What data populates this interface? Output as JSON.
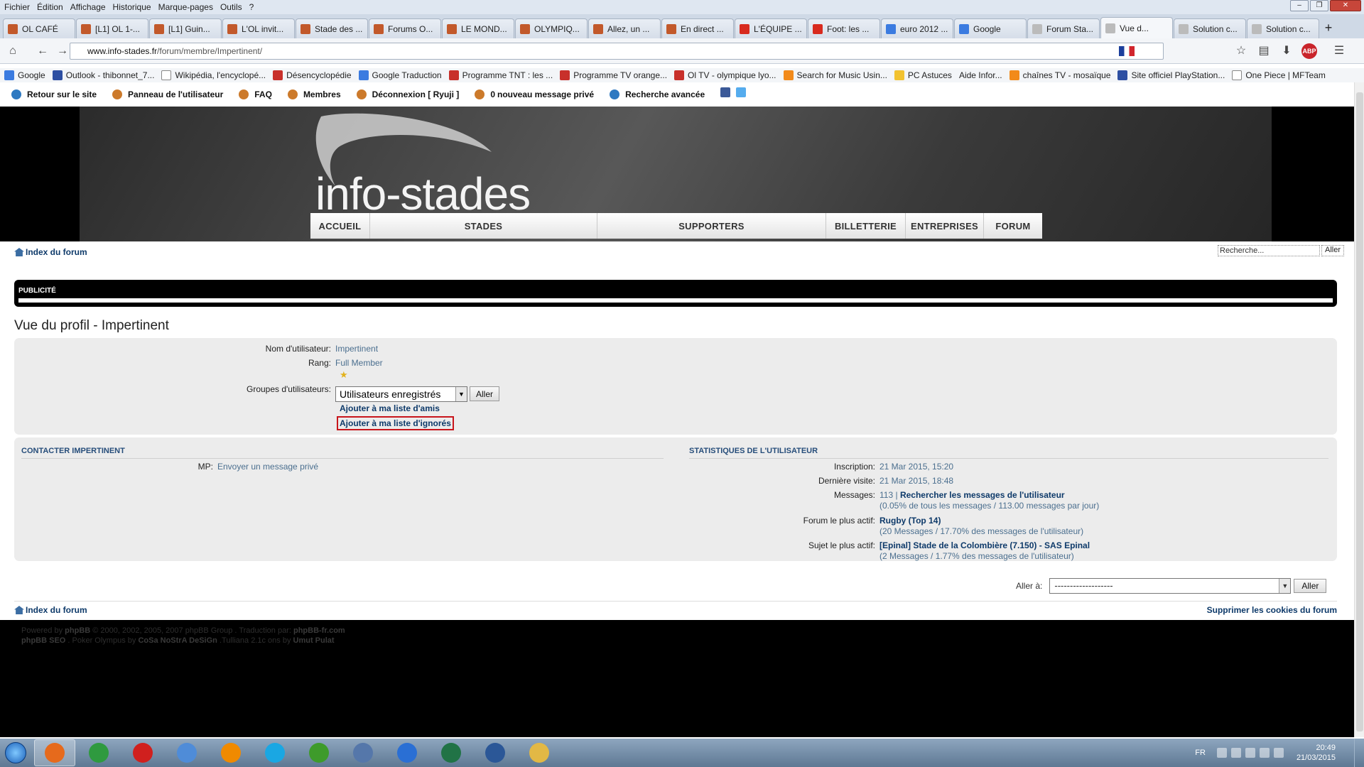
{
  "browser": {
    "menu": [
      "Fichier",
      "Édition",
      "Affichage",
      "Historique",
      "Marque-pages",
      "Outils",
      "?"
    ],
    "tabs": [
      {
        "label": "OL CAFÉ",
        "icon": "ol-favicon"
      },
      {
        "label": "[L1] OL 1-...",
        "icon": "ol-favicon"
      },
      {
        "label": "[L1] Guin...",
        "icon": "ol-favicon"
      },
      {
        "label": "L'OL invit...",
        "icon": "ol-favicon"
      },
      {
        "label": "Stade des ...",
        "icon": "ol-favicon"
      },
      {
        "label": "Forums O...",
        "icon": "ol-favicon"
      },
      {
        "label": "LE MOND...",
        "icon": "ol-favicon"
      },
      {
        "label": "OLYMPIQ...",
        "icon": "ol-favicon"
      },
      {
        "label": "Allez, un ...",
        "icon": "ol-favicon"
      },
      {
        "label": "En direct ...",
        "icon": "ol-favicon"
      },
      {
        "label": "L'ÉQUIPE ...",
        "icon": "lequipe-favicon"
      },
      {
        "label": "Foot: les ...",
        "icon": "lequipe-favicon"
      },
      {
        "label": "euro 2012 ...",
        "icon": "google-favicon"
      },
      {
        "label": "Google",
        "icon": "google-favicon"
      },
      {
        "label": "Forum Sta...",
        "icon": "page-favicon"
      },
      {
        "label": "Vue d...",
        "icon": "page-favicon",
        "active": true
      },
      {
        "label": "Solution c...",
        "icon": "page-favicon"
      },
      {
        "label": "Solution c...",
        "icon": "page-favicon"
      }
    ],
    "url_domain": "www.info-stades.fr",
    "url_path": "/forum/membre/Impertinent/",
    "bookmarks": [
      {
        "label": "Google",
        "icon": "google-icon",
        "c": ""
      },
      {
        "label": "Outlook - thibonnet_7...",
        "icon": "outlook-icon",
        "c": "b"
      },
      {
        "label": "Wikipédia, l'encyclopé...",
        "icon": "wikipedia-icon",
        "c": "n"
      },
      {
        "label": "Désencyclopédie",
        "icon": "desencyclopedie-icon",
        "c": "r"
      },
      {
        "label": "Google Traduction",
        "icon": "translate-icon",
        "c": ""
      },
      {
        "label": "Programme TNT : les ...",
        "icon": "tele-loisirs-icon",
        "c": "r"
      },
      {
        "label": "Programme TV orange...",
        "icon": "tele-loisirs-icon",
        "c": "r"
      },
      {
        "label": "Ol TV - olympique lyo...",
        "icon": "ol-tv-icon",
        "c": "r"
      },
      {
        "label": "Search for Music Usin...",
        "icon": "music-icon",
        "c": "o"
      },
      {
        "label": "PC Astuces",
        "icon": "bulb-icon",
        "c": "y"
      },
      {
        "label": "Aide Infor...",
        "icon": "",
        "c": "none"
      },
      {
        "label": "chaînes TV - mosaïque",
        "icon": "folder-icon",
        "c": "o"
      },
      {
        "label": "Site officiel PlayStation...",
        "icon": "playstation-icon",
        "c": "b"
      },
      {
        "label": "One Piece | MFTeam",
        "icon": "page-icon",
        "c": "n"
      }
    ]
  },
  "forum_nav": {
    "back": "Retour sur le site",
    "panel": "Panneau de l'utilisateur",
    "faq": "FAQ",
    "members": "Membres",
    "logout": "Déconnexion [ Ryuji ]",
    "pm_count": "0",
    "pm_text": "nouveau message privé",
    "adv_search": "Recherche avancée"
  },
  "site": {
    "logo": "info-stades",
    "menu": [
      "ACCUEIL",
      "STADES",
      "SUPPORTERS",
      "BILLETTERIE",
      "ENTREPRISES",
      "FORUM"
    ]
  },
  "breadcrumb": "Index du forum",
  "search": {
    "placeholder": "Recherche...",
    "button": "Aller"
  },
  "ad_label": "PUBLICITÉ",
  "profile": {
    "title": "Vue du profil - Impertinent",
    "username_label": "Nom d'utilisateur:",
    "username": "Impertinent",
    "rank_label": "Rang:",
    "rank": "Full Member",
    "rank_stars": 1,
    "groups_label": "Groupes d'utilisateurs:",
    "group_selected": "Utilisateurs enregistrés",
    "group_button": "Aller",
    "add_friend": "Ajouter à ma liste d'amis",
    "add_foe": "Ajouter à ma liste d'ignorés"
  },
  "contact": {
    "title": "CONTACTER IMPERTINENT",
    "pm_label": "MP:",
    "pm_link": "Envoyer un message privé"
  },
  "stats": {
    "title": "STATISTIQUES DE L'UTILISATEUR",
    "joined_label": "Inscription:",
    "joined": "21 Mar 2015, 15:20",
    "last_visit_label": "Dernière visite:",
    "last_visit": "21 Mar 2015, 18:48",
    "posts_label": "Messages:",
    "posts_count": "113 |",
    "posts_link": "Rechercher les messages de l'utilisateur",
    "posts_sub": "(0.05% de tous les messages / 113.00 messages par jour)",
    "active_forum_label": "Forum le plus actif:",
    "active_forum": "Rugby (Top 14)",
    "active_forum_sub": "(20 Messages / 17.70% des messages de l'utilisateur)",
    "active_topic_label": "Sujet le plus actif:",
    "active_topic": "[Epinal] Stade de la Colombière (7.150) - SAS Epinal",
    "active_topic_sub": "(2 Messages / 1.77% des messages de l'utilisateur)"
  },
  "jumpbox": {
    "label": "Aller à:",
    "selected": "-------------------",
    "button": "Aller"
  },
  "footer": {
    "breadcrumb": "Index du forum",
    "delete_cookies": "Supprimer les cookies du forum",
    "line1_prefix": "Powered by",
    "line1_phpbb": "phpBB",
    "line1_mid": "© 2000, 2002, 2005, 2007 phpBB Group . Traduction par:",
    "line1_fr": "phpBB-fr.com",
    "line2_seo": "phpBB SEO",
    "line2_mid": ". Poker Olympus by",
    "line2_design": "CoSa NoStrA DeSiGn",
    "line2_mid2": ".Tulliana 2.1c ons by",
    "line2_author": "Umut Pulat"
  },
  "taskbar": {
    "apps": [
      "firefox-icon",
      "chrome-icon",
      "opera-icon",
      "media-player-icon",
      "vlc-icon",
      "skype-icon",
      "utorrent-icon",
      "editor-icon",
      "earth-icon",
      "excel-icon",
      "word-icon",
      "explorer-icon"
    ],
    "lang": "FR",
    "time": "20:49",
    "date": "21/03/2015"
  },
  "colors": {
    "link": "#0e3a6a",
    "value": "#4b6f8f",
    "highlight_border": "#c8151b",
    "banner_bg": "#000000"
  }
}
